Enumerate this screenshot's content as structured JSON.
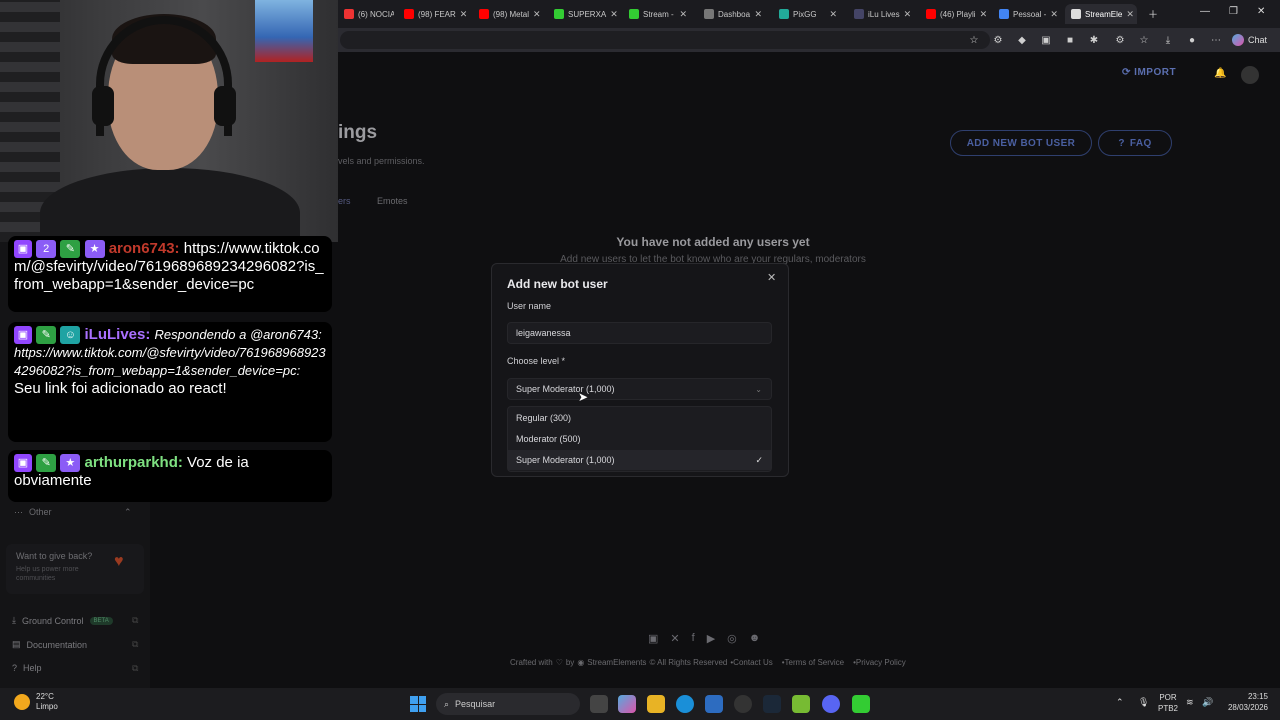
{
  "browser": {
    "tabs": [
      {
        "label": "(6) NOCIA",
        "color": "#e33"
      },
      {
        "label": "(98) FEAR",
        "color": "#f00"
      },
      {
        "label": "(98) Metal",
        "color": "#f00"
      },
      {
        "label": "SUPERXA",
        "color": "#3c3"
      },
      {
        "label": "Stream -",
        "color": "#3c3"
      },
      {
        "label": "Dashboa",
        "color": "#777"
      },
      {
        "label": "PixGG",
        "color": "#2a9"
      },
      {
        "label": "iLu Lives",
        "color": "#446"
      },
      {
        "label": "(46) Playli",
        "color": "#f00"
      },
      {
        "label": "Pessoal -",
        "color": "#4285f4"
      },
      {
        "label": "StreamEle",
        "color": "#ddd"
      }
    ],
    "chat_label": "Chat"
  },
  "header": {
    "import_label": "IMPORT"
  },
  "page": {
    "title": "ings",
    "subtitle": "vels and permissions.",
    "add_button": "ADD NEW BOT USER",
    "faq_button": "FAQ",
    "tab_users": "ers",
    "tab_emotes": "Emotes",
    "empty_title": "You have not added any users yet",
    "empty_sub": "Add new users to let the bot know who are your regulars, moderators"
  },
  "sidebar": {
    "other_label": "Other",
    "give_title": "Want to give back?",
    "give_sub": "Help us power more communities",
    "ground_control": "Ground Control",
    "beta": "BETA",
    "documentation": "Documentation",
    "help": "Help"
  },
  "modal": {
    "title": "Add new bot user",
    "username_label": "User name",
    "username_value": "leigawanessa",
    "level_label": "Choose level *",
    "level_value": "Super Moderator (1,000)",
    "options": [
      {
        "label": "Regular (300)",
        "selected": false
      },
      {
        "label": "Moderator (500)",
        "selected": false
      },
      {
        "label": "Super Moderator (1,000)",
        "selected": true
      }
    ]
  },
  "footer": {
    "crafted": "Crafted with",
    "by": "by",
    "brand": "StreamElements",
    "rights": "© All Rights Reserved",
    "contact": "•Contact Us",
    "terms": "•Terms of Service",
    "privacy": "•Privacy Policy"
  },
  "chat": {
    "msg1_name": "aron6743:",
    "msg1_text": "https://www.tiktok.com/@sfevirty/video/7619689689234296082?is_from_webapp=1&sender_device=pc",
    "msg2_name": "iLuLives:",
    "msg2_reply": "Respondendo a @aron6743: https://www.tiktok.com/@sfevirty/video/7619689689234296082?is_from_webapp=1&sender_device=pc:",
    "msg2_text": "Seu link foi adicionado ao react!",
    "msg3_name": "arthurparkhd:",
    "msg3_text": "Voz de ia obviamente"
  },
  "taskbar": {
    "temp": "22°C",
    "weather": "Limpo",
    "search": "Pesquisar",
    "lang1": "POR",
    "lang2": "PTB2",
    "time": "23:15",
    "date": "28/03/2026"
  }
}
